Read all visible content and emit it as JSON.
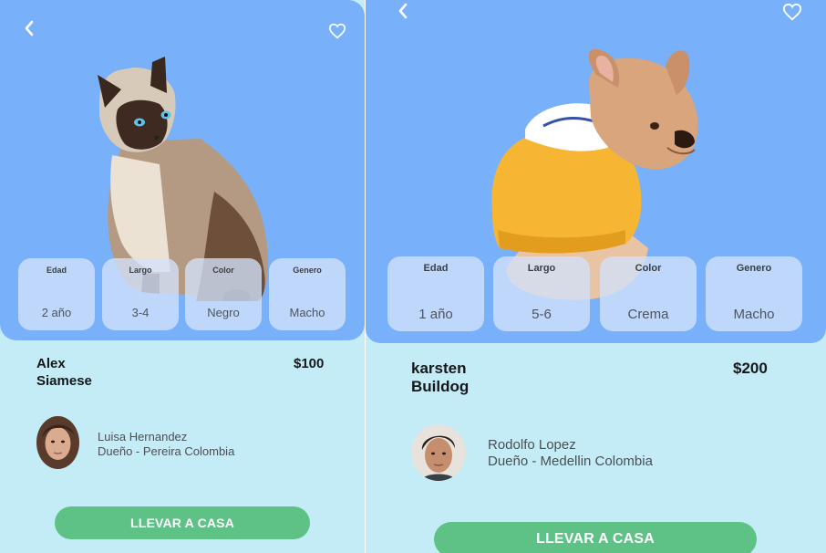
{
  "colors": {
    "hero": "#78b1fa",
    "background": "#c3ecf7",
    "cta": "#5ec185",
    "chip": "#d2e2fa"
  },
  "left": {
    "icons": {
      "back": "chevron-left-icon",
      "favorite": "heart-outline-icon"
    },
    "pet": "siamese-cat",
    "attributes": [
      {
        "label": "Edad",
        "value": "2 año"
      },
      {
        "label": "Largo",
        "value": "3-4"
      },
      {
        "label": "Color",
        "value": "Negro"
      },
      {
        "label": "Genero",
        "value": "Macho"
      }
    ],
    "name": "Alex",
    "breed": "Siamese",
    "price": "$100",
    "owner": {
      "name": "Luisa Hernandez",
      "location": "Dueño - Pereira Colombia"
    },
    "cta": "LLEVAR A CASA"
  },
  "right": {
    "icons": {
      "back": "chevron-left-icon",
      "favorite": "heart-outline-icon"
    },
    "pet": "french-bulldog-in-hoodie",
    "attributes": [
      {
        "label": "Edad",
        "value": "1 año"
      },
      {
        "label": "Largo",
        "value": "5-6"
      },
      {
        "label": "Color",
        "value": "Crema"
      },
      {
        "label": "Genero",
        "value": "Macho"
      }
    ],
    "name": "karsten",
    "breed": "Buildog",
    "price": "$200",
    "owner": {
      "name": "Rodolfo Lopez",
      "location": "Dueño - Medellin Colombia"
    },
    "cta": "LLEVAR A CASA"
  }
}
